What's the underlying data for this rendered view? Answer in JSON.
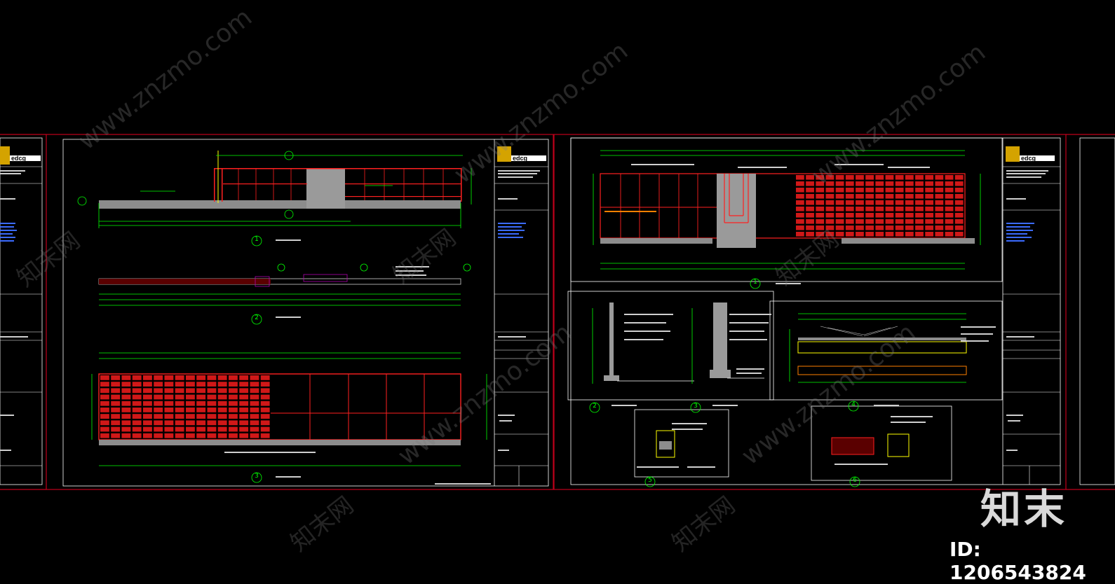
{
  "watermark": {
    "site": "www.znzmo.com",
    "cn": "知末网",
    "logo": "知末",
    "id_label": "ID: 1206543824"
  },
  "sheets": [
    {
      "brand": "edcg",
      "views": [
        "1",
        "2",
        "3"
      ]
    },
    {
      "brand": "edcg",
      "views": [
        "1",
        "2",
        "3",
        "4",
        "5",
        "6"
      ]
    }
  ],
  "colors": {
    "background": "#000000",
    "frame": "#ffffff",
    "sheet_border": "#c0001a",
    "dimension": "#00ff00",
    "wall": "#ff2020",
    "hatch": "#9a9a9a",
    "note_blue": "#3b6bff",
    "yellow": "#ffff00"
  }
}
